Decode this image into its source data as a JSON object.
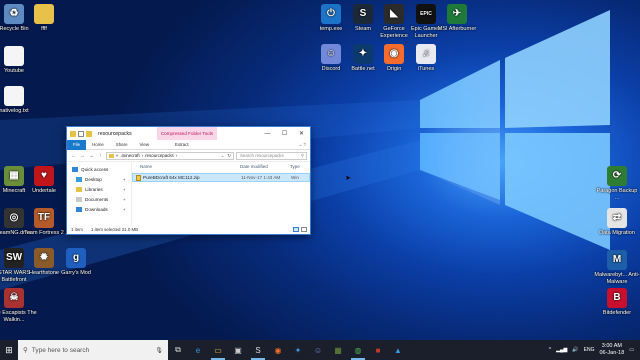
{
  "desktop": {
    "icons": [
      {
        "label": "Recycle Bin",
        "icon": "recycle-bin-icon",
        "color": "#5e8bc2",
        "glyph": "♻"
      },
      {
        "label": "ffff",
        "icon": "folder-icon",
        "color": "#e8c14a",
        "glyph": ""
      },
      {
        "label": "Youtube",
        "icon": "document-icon",
        "color": "#f5f5f5",
        "glyph": ""
      },
      {
        "label": "nativelog.txt",
        "icon": "text-file-icon",
        "color": "#f5f5f5",
        "glyph": ""
      },
      {
        "label": "Minecraft",
        "icon": "minecraft-icon",
        "color": "#6b8e3a",
        "glyph": "▦"
      },
      {
        "label": "Undertale",
        "icon": "undertale-icon",
        "color": "#c0151b",
        "glyph": "♥"
      },
      {
        "label": "BeamNG.drive",
        "icon": "beamng-icon",
        "color": "#333333",
        "glyph": "◎"
      },
      {
        "label": "Team Fortress 2",
        "icon": "tf2-icon",
        "color": "#b55a2a",
        "glyph": "TF"
      },
      {
        "label": "STAR WARS Battlefront",
        "icon": "battlefront-icon",
        "color": "#222222",
        "glyph": "SW"
      },
      {
        "label": "Hearthstone",
        "icon": "hearthstone-icon",
        "color": "#8a5a2b",
        "glyph": "✹"
      },
      {
        "label": "Garry's Mod",
        "icon": "garrys-mod-icon",
        "color": "#1f5fbf",
        "glyph": "g"
      },
      {
        "label": "The Escapists The Walkin...",
        "icon": "escapists-icon",
        "color": "#a83232",
        "glyph": "☠"
      },
      {
        "label": "temp.exe",
        "icon": "temp-exe-icon",
        "color": "#1c74c9",
        "glyph": "⏻"
      },
      {
        "label": "Steam",
        "icon": "steam-icon",
        "color": "#1b2838",
        "glyph": "S"
      },
      {
        "label": "GeForce Experience",
        "icon": "geforce-icon",
        "color": "#2b2b2b",
        "glyph": "◣"
      },
      {
        "label": "Epic Games Launcher",
        "icon": "epic-games-icon",
        "color": "#111111",
        "glyph": "EPIC"
      },
      {
        "label": "MSI Afterburner",
        "icon": "msi-afterburner-icon",
        "color": "#1f7a3a",
        "glyph": "✈"
      },
      {
        "label": "Discord",
        "icon": "discord-icon",
        "color": "#7289da",
        "glyph": "☺"
      },
      {
        "label": "Battle.net",
        "icon": "battlenet-icon",
        "color": "#0d3a6e",
        "glyph": "✦"
      },
      {
        "label": "Origin",
        "icon": "origin-icon",
        "color": "#f56c2d",
        "glyph": "◉"
      },
      {
        "label": "iTunes",
        "icon": "itunes-icon",
        "color": "#e9e9f2",
        "glyph": "♫"
      },
      {
        "label": "Paragon Backup ...",
        "icon": "paragon-backup-icon",
        "color": "#2f7d32",
        "glyph": "⟳"
      },
      {
        "label": "Data Migration",
        "icon": "data-migration-icon",
        "color": "#e5e5e5",
        "glyph": "⇄"
      },
      {
        "label": "Malwarebyt... Anti-Malware",
        "icon": "malwarebytes-icon",
        "color": "#1c5fa8",
        "glyph": "M"
      },
      {
        "label": "Bitdefender",
        "icon": "bitdefender-icon",
        "color": "#c8102e",
        "glyph": "B"
      }
    ]
  },
  "explorer": {
    "title": "resourcepacks",
    "tools_tab": "Compressed Folder Tools",
    "ribbon_tabs": [
      "File",
      "Home",
      "Share",
      "View",
      "Extract"
    ],
    "path": [
      ".minecraft",
      "resourcepacks"
    ],
    "path_prefix": "«",
    "search_placeholder": "Search resourcepacks",
    "nav": [
      {
        "label": "Quick access",
        "icon": "star-icon",
        "color": "#2f86d6"
      },
      {
        "label": "Desktop",
        "icon": "desktop-icon",
        "color": "#3a9be0"
      },
      {
        "label": "Libraries",
        "icon": "libraries-icon",
        "color": "#e8c14a"
      },
      {
        "label": "Documents",
        "icon": "documents-icon",
        "color": "#c9c9c9"
      },
      {
        "label": "Downloads",
        "icon": "downloads-icon",
        "color": "#2f86d6"
      }
    ],
    "columns": [
      "Name",
      "Date modified",
      "Type"
    ],
    "files": [
      {
        "name": "PureBDcraft  64x MC112.zip",
        "date": "11-Nov-17 1:43 AM",
        "type": "Win"
      }
    ],
    "status_count": "1 item",
    "status_selected": "1 item selected  21.0 MB"
  },
  "taskbar": {
    "search_placeholder": "Type here to search",
    "icons": [
      "task-view-icon",
      "edge-icon",
      "file-explorer-icon",
      "store-icon",
      "steam-taskbar-icon",
      "origin-taskbar-icon",
      "battlenet-taskbar-icon",
      "discord-taskbar-icon",
      "minecraft-taskbar-icon",
      "chrome-icon",
      "app-icon",
      "app-icon-2"
    ],
    "language": "ENG",
    "time": "3:00 AM",
    "date": "06-Jan-18"
  }
}
